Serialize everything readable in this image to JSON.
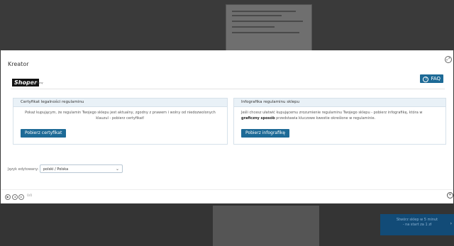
{
  "modal": {
    "title": "Kreator",
    "faq_label": "FAQ",
    "logo": {
      "brand": "Shoper",
      "sub": "regulaminy"
    },
    "panels": [
      {
        "heading": "Certyfikat legalności regulaminu",
        "body": "Pokaż kupującym, że regulamin Twojego sklepu jest aktualny, zgodny z prawem i wolny od niedozwolonych klauzul - pobierz certyfikat!",
        "button": "Pobierz certyfikat"
      },
      {
        "heading": "Infografika regulaminu sklepu",
        "body_pre": "Jeśli chcesz ułatwić kupującemu zrozumienie regulaminu Twojego sklepu - pobierz infografikę, która w ",
        "body_bold": "graficzny sposób",
        "body_post": " przedstawia kluczowe kwestie określone w regulaminie.",
        "button": "Pobierz infografikę"
      }
    ],
    "language": {
      "label": "Język edytowany:",
      "selected": "polski / Polska"
    },
    "pager": "0/0"
  },
  "promo": {
    "line1": "Stwórz sklep w 5 minut",
    "line2": "- na start za 1 zł"
  },
  "icons": [
    "expand-icon",
    "question-icon",
    "play-icon",
    "prev-icon",
    "next-icon",
    "close-icon",
    "chevron-down-icon"
  ],
  "colors": {
    "accent": "#1d6a96",
    "panel_head": "#e9f1f7",
    "overlay": "#3a3a3a"
  }
}
